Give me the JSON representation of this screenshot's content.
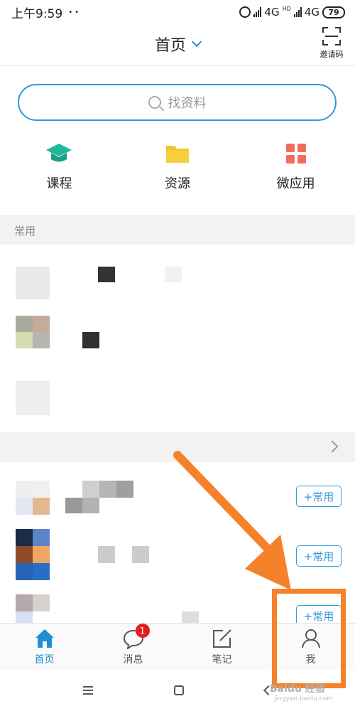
{
  "status": {
    "time": "上午9:59",
    "dots": "• •",
    "net1": "4G",
    "hd": "HD",
    "net2": "4G",
    "battery": "79"
  },
  "header": {
    "title": "首页",
    "invite_label": "邀请码"
  },
  "search": {
    "placeholder": "找资料"
  },
  "quick": [
    {
      "label": "课程",
      "icon": "graduation-cap-icon",
      "color": "#20b89a"
    },
    {
      "label": "资源",
      "icon": "folder-icon",
      "color": "#f5c42b"
    },
    {
      "label": "微应用",
      "icon": "grid-apps-icon",
      "color": "#f26b5b"
    }
  ],
  "sections": {
    "common": "常用"
  },
  "list": {
    "add_label": "+常用"
  },
  "nav": [
    {
      "label": "首页",
      "icon": "home-icon"
    },
    {
      "label": "消息",
      "icon": "chat-icon",
      "badge": "1"
    },
    {
      "label": "笔记",
      "icon": "note-edit-icon"
    },
    {
      "label": "我",
      "icon": "user-icon"
    }
  ],
  "colors": {
    "accent": "#1e90d6",
    "annotation": "#f5822a",
    "badge": "#e02020"
  },
  "watermark": {
    "text": "Baidu 经验",
    "sub": "jingyan.baidu.com"
  }
}
